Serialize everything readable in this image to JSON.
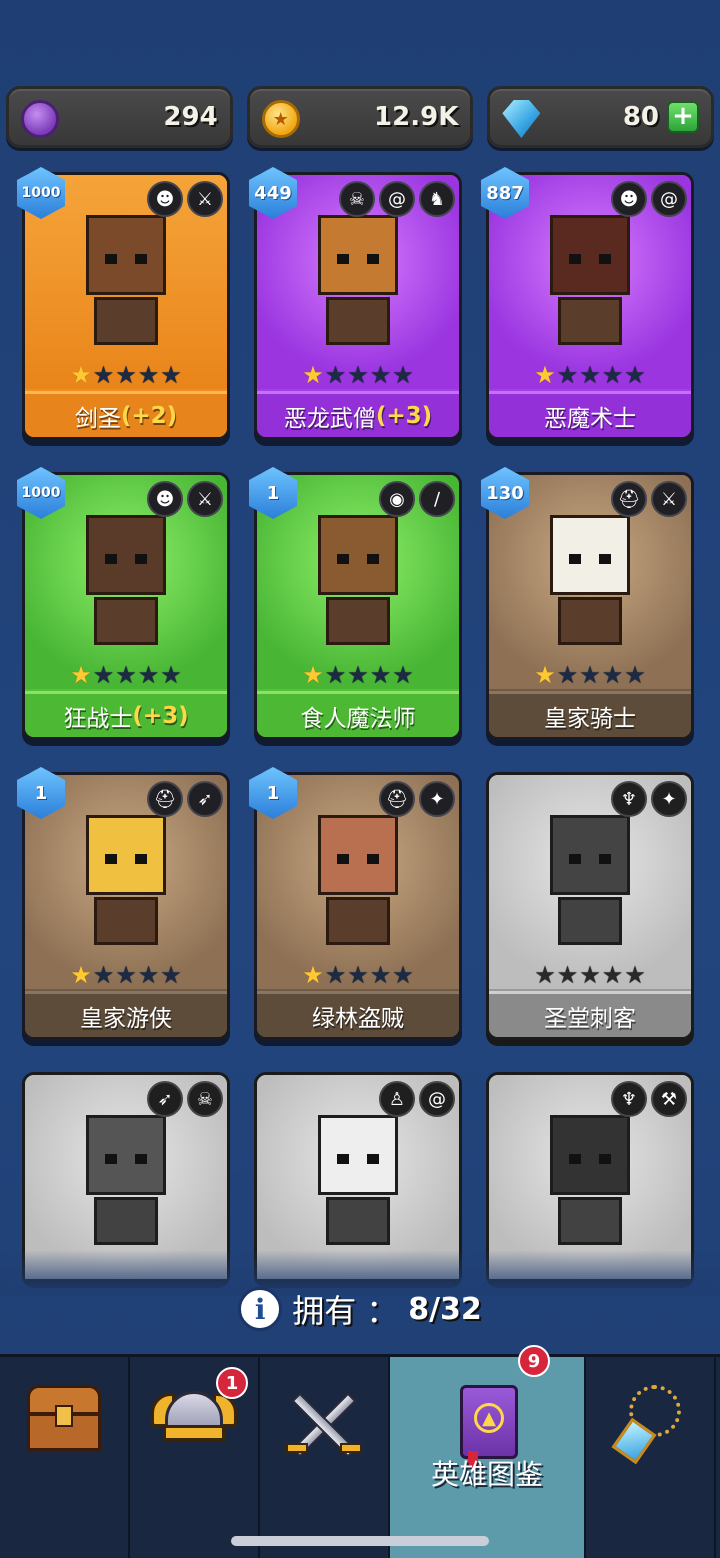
{
  "currency": {
    "purple_amount": "294",
    "gold_amount": "12.9K",
    "gem_amount": "80",
    "add_label": "+"
  },
  "heroes": [
    {
      "name": "剑圣",
      "bonus": "(+2)",
      "level": "1000",
      "stars": 1,
      "rarity": "orange",
      "owned": true,
      "tags": [
        "orc-face-icon",
        "sword-icon"
      ]
    },
    {
      "name": "恶龙武僧",
      "bonus": "(+3)",
      "level": "449",
      "stars": 1,
      "rarity": "purple",
      "owned": true,
      "tags": [
        "skull-icon",
        "swirl-icon",
        "dragon-icon"
      ]
    },
    {
      "name": "恶魔术士",
      "bonus": "",
      "level": "887",
      "stars": 1,
      "rarity": "purple",
      "owned": true,
      "tags": [
        "orc-face-icon",
        "swirl-icon"
      ]
    },
    {
      "name": "狂战士",
      "bonus": "(+3)",
      "level": "1000",
      "stars": 1,
      "rarity": "green",
      "owned": true,
      "tags": [
        "orc-face-icon",
        "sword-icon"
      ]
    },
    {
      "name": "食人魔法师",
      "bonus": "",
      "level": "1",
      "stars": 1,
      "rarity": "green",
      "owned": true,
      "tags": [
        "cyclops-icon",
        "staff-icon"
      ]
    },
    {
      "name": "皇家骑士",
      "bonus": "",
      "level": "130",
      "stars": 1,
      "rarity": "brown",
      "owned": true,
      "tags": [
        "helmet-icon",
        "sword-icon"
      ]
    },
    {
      "name": "皇家游侠",
      "bonus": "",
      "level": "1",
      "stars": 1,
      "rarity": "brown",
      "owned": true,
      "tags": [
        "helmet-icon",
        "bow-icon"
      ]
    },
    {
      "name": "绿林盗贼",
      "bonus": "",
      "level": "1",
      "stars": 1,
      "rarity": "brown",
      "owned": true,
      "tags": [
        "helmet-icon",
        "dagger-icon"
      ]
    },
    {
      "name": "圣堂刺客",
      "bonus": "",
      "level": "",
      "stars": 0,
      "rarity": "gray",
      "owned": false,
      "tags": [
        "wings-icon",
        "dagger-icon"
      ]
    },
    {
      "name": "",
      "bonus": "",
      "level": "",
      "stars": 0,
      "rarity": "gray",
      "owned": false,
      "tags": [
        "bow-icon",
        "skull-icon"
      ]
    },
    {
      "name": "",
      "bonus": "",
      "level": "",
      "stars": 0,
      "rarity": "gray",
      "owned": false,
      "tags": [
        "shaman-icon",
        "swirl-icon"
      ]
    },
    {
      "name": "",
      "bonus": "",
      "level": "",
      "stars": 0,
      "rarity": "gray",
      "owned": false,
      "tags": [
        "wings-icon",
        "hammer-icon"
      ]
    }
  ],
  "owned": {
    "label": "拥有",
    "separator": "：",
    "count": "8/32"
  },
  "nav": {
    "items": [
      {
        "id": "chest",
        "icon": "treasure-chest-icon",
        "badge": ""
      },
      {
        "id": "hero",
        "icon": "winged-helmet-icon",
        "badge": "1"
      },
      {
        "id": "battle",
        "icon": "crossed-swords-icon",
        "badge": ""
      },
      {
        "id": "codex",
        "icon": "spell-book-icon",
        "badge": "9",
        "label": "英雄图鉴",
        "active": true
      },
      {
        "id": "equipment",
        "icon": "amulet-icon",
        "badge": ""
      }
    ]
  },
  "colors": {
    "background": "#22457e",
    "orange": "#f08f1e",
    "purple": "#a43ee8",
    "green": "#53c23a",
    "brown": "#6e5a45",
    "nav_active": "#5d9aaa",
    "badge_red": "#d6263c"
  }
}
